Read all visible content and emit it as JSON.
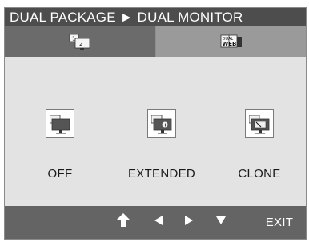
{
  "title": {
    "text": "DUAL PACKAGE ► DUAL MONITOR"
  },
  "tabs": [
    {
      "icon": "dual-monitor-icon",
      "selected": true
    },
    {
      "icon": "dual-web-icon",
      "selected": false
    }
  ],
  "options": [
    {
      "label": "OFF",
      "icon": "monitor-off-icon"
    },
    {
      "label": "EXTENDED",
      "icon": "monitor-extended-icon"
    },
    {
      "label": "CLONE",
      "icon": "monitor-clone-icon"
    }
  ],
  "bottom_bar": {
    "buttons": [
      "up-arrow-icon",
      "left-arrow-icon",
      "right-arrow-icon",
      "down-arrow-icon"
    ],
    "exit_label": "EXIT"
  },
  "colors": {
    "title_bar": "#4d4d4d",
    "panel": "#e3e3e3",
    "tab_selected": "#6b6b6b",
    "tab_unselected": "#9a9a9a",
    "bottom_bar": "#646464"
  }
}
